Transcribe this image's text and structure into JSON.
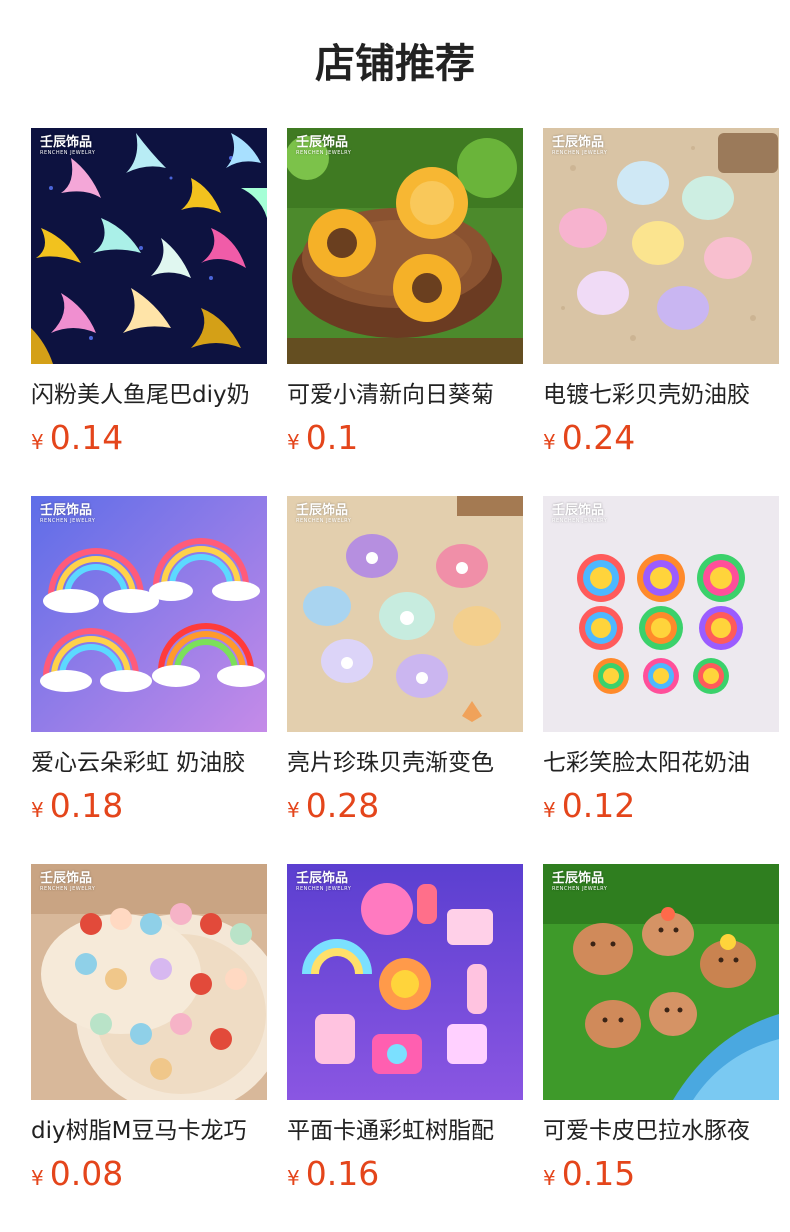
{
  "section": {
    "title": "店铺推荐"
  },
  "brand_watermark": {
    "cn": "壬辰饰品",
    "en": "RENCHEN JEWELRY"
  },
  "products": [
    {
      "name": "闪粉美人鱼尾巴diy奶",
      "currency": "¥",
      "price": "0.14",
      "image": "mermaid-tail-charms"
    },
    {
      "name": "可爱小清新向日葵菊",
      "currency": "¥",
      "price": "0.1",
      "image": "sunflower-charms"
    },
    {
      "name": "电镀七彩贝壳奶油胶",
      "currency": "¥",
      "price": "0.24",
      "image": "iridescent-shell-charms"
    },
    {
      "name": "爱心云朵彩虹 奶油胶",
      "currency": "¥",
      "price": "0.18",
      "image": "rainbow-cloud-charms"
    },
    {
      "name": "亮片珍珠贝壳渐变色",
      "currency": "¥",
      "price": "0.28",
      "image": "pearl-shell-charms"
    },
    {
      "name": "七彩笑脸太阳花奶油",
      "currency": "¥",
      "price": "0.12",
      "image": "smiley-flower-charms"
    },
    {
      "name": "diy树脂M豆马卡龙巧",
      "currency": "¥",
      "price": "0.08",
      "image": "m-candy-charms"
    },
    {
      "name": "平面卡通彩虹树脂配",
      "currency": "¥",
      "price": "0.16",
      "image": "cartoon-flat-charms"
    },
    {
      "name": "可爱卡皮巴拉水豚夜",
      "currency": "¥",
      "price": "0.15",
      "image": "capybara-charms"
    }
  ],
  "colors": {
    "price": "#e4451b",
    "title": "#222222"
  }
}
